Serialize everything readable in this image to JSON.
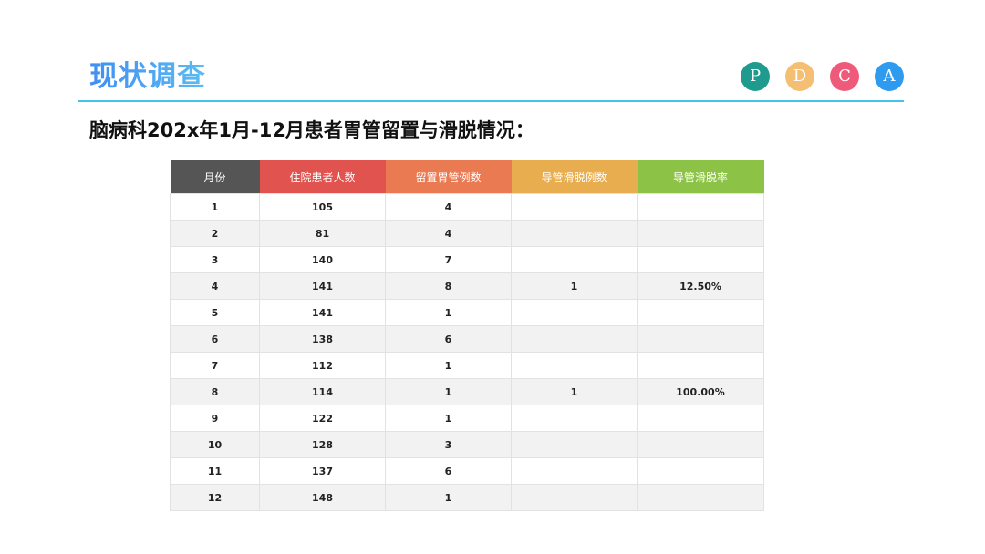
{
  "header": {
    "title": "现状调查",
    "pdca": [
      {
        "letter": "P",
        "color": "#1f9a8f"
      },
      {
        "letter": "D",
        "color": "#f4bf72"
      },
      {
        "letter": "C",
        "color": "#f05a7a"
      },
      {
        "letter": "A",
        "color": "#2f9bef"
      }
    ],
    "divider_color": "#3ec6e4"
  },
  "subtitle": "脑病科202x年1月-12月患者胃管留置与滑脱情况：",
  "table": {
    "columns": [
      {
        "label": "月份",
        "color": "#555555"
      },
      {
        "label": "住院患者人数",
        "color": "#e0534f"
      },
      {
        "label": "留置胃管例数",
        "color": "#ea7a52"
      },
      {
        "label": "导管滑脱例数",
        "color": "#e8ad4e"
      },
      {
        "label": "导管滑脱率",
        "color": "#8cc346"
      }
    ],
    "rows": [
      [
        "1",
        "105",
        "4",
        "",
        ""
      ],
      [
        "2",
        "81",
        "4",
        "",
        ""
      ],
      [
        "3",
        "140",
        "7",
        "",
        ""
      ],
      [
        "4",
        "141",
        "8",
        "1",
        "12.50%"
      ],
      [
        "5",
        "141",
        "1",
        "",
        ""
      ],
      [
        "6",
        "138",
        "6",
        "",
        ""
      ],
      [
        "7",
        "112",
        "1",
        "",
        ""
      ],
      [
        "8",
        "114",
        "1",
        "1",
        "100.00%"
      ],
      [
        "9",
        "122",
        "1",
        "",
        ""
      ],
      [
        "10",
        "128",
        "3",
        "",
        ""
      ],
      [
        "11",
        "137",
        "6",
        "",
        ""
      ],
      [
        "12",
        "148",
        "1",
        "",
        ""
      ]
    ]
  }
}
